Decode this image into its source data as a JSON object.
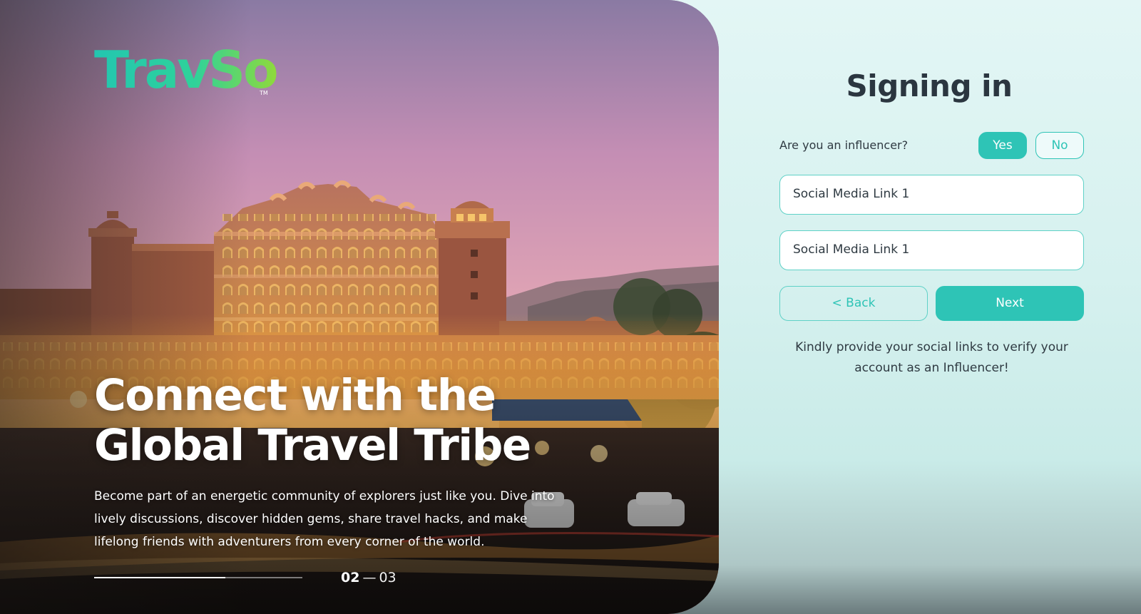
{
  "brand": {
    "logo_text": "TravSo",
    "trademark": "TM"
  },
  "hero": {
    "headline_line1": "Connect with the",
    "headline_line2": "Global Travel Tribe",
    "description": "Become part of an energetic community of explorers just like you. Dive into lively discussions, discover hidden gems, share travel hacks, and make lifelong friends with adventurers from every corner of the world.",
    "carousel": {
      "current": "02",
      "separator": "—",
      "total": "03",
      "progress": 0.63
    }
  },
  "form": {
    "title": "Signing in",
    "question": "Are you an influencer?",
    "yes_label": "Yes",
    "no_label": "No",
    "selected": "Yes",
    "social_link_1_value": "Social Media Link 1",
    "social_link_2_value": "Social Media Link 1",
    "back_label": "< Back",
    "next_label": "Next",
    "note": "Kindly provide your social links to verify your account as an Influencer!"
  },
  "colors": {
    "accent": "#2ec4b6",
    "logo_gradient_start": "#23c6b0",
    "logo_gradient_end": "#8fd93c",
    "panel_bg": "#dff4f3",
    "text_dark": "#2b3640"
  }
}
